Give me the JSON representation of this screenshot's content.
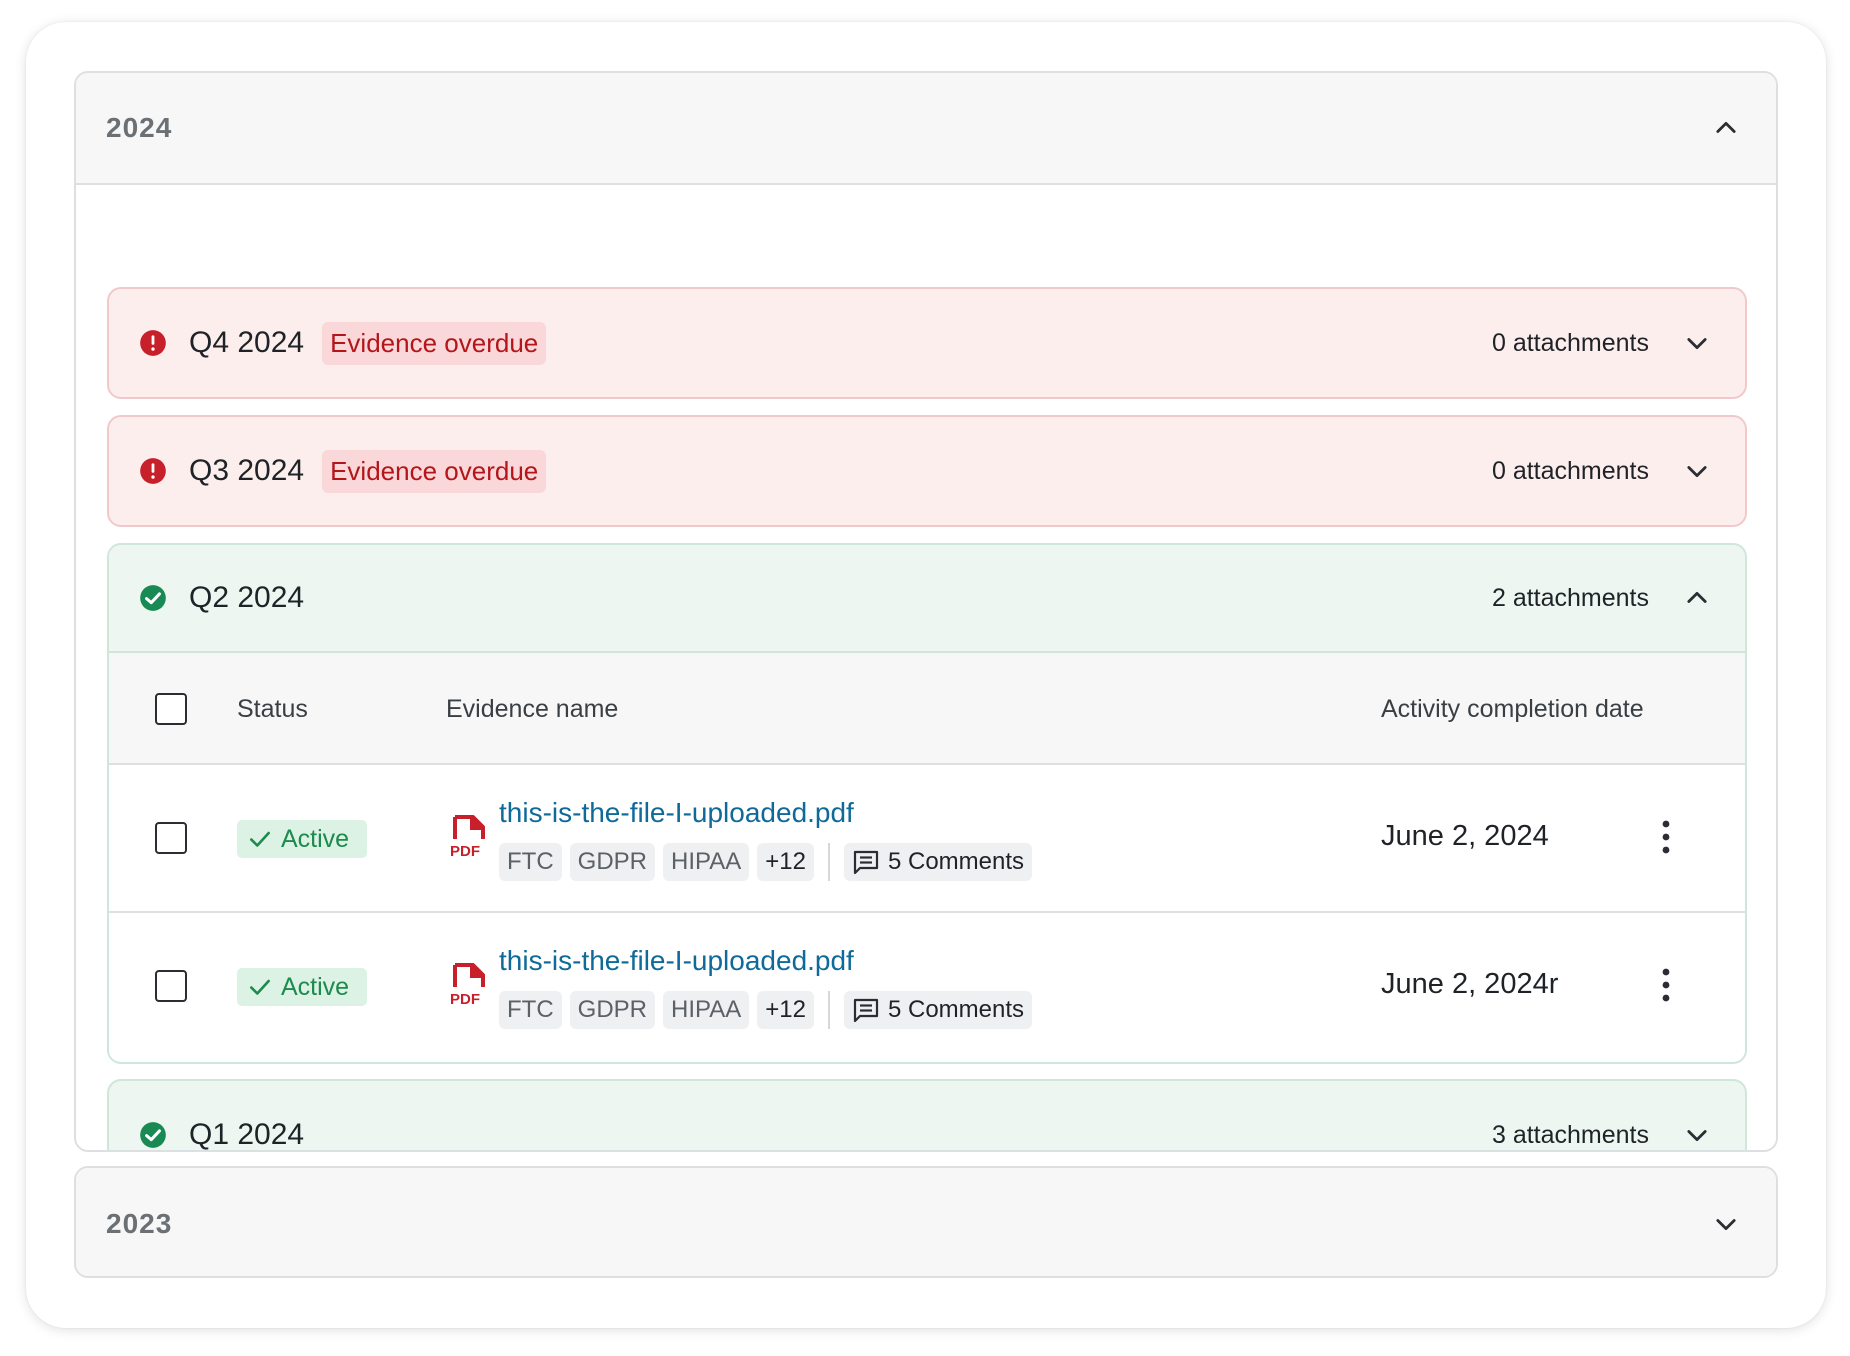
{
  "years": {
    "y2024": {
      "label": "2024",
      "expanded": true
    },
    "y2023": {
      "label": "2023",
      "expanded": false
    }
  },
  "quarters": {
    "q4": {
      "label": "Q4 2024",
      "badge": "Evidence overdue",
      "attachments": "0 attachments",
      "status": "overdue"
    },
    "q3": {
      "label": "Q3 2024",
      "badge": "Evidence overdue",
      "attachments": "0 attachments",
      "status": "overdue"
    },
    "q2": {
      "label": "Q2 2024",
      "attachments": "2 attachments",
      "status": "complete",
      "expanded": true
    },
    "q1": {
      "label": "Q1 2024",
      "attachments": "3 attachments",
      "status": "complete"
    }
  },
  "table": {
    "headers": {
      "status": "Status",
      "name": "Evidence name",
      "date": "Activity completion date"
    },
    "rows": [
      {
        "status": "Active",
        "file": "this-is-the-file-I-uploaded.pdf",
        "file_type": "PDF",
        "tags": [
          "FTC",
          "GDPR",
          "HIPAA",
          "+12"
        ],
        "comments": "5 Comments",
        "date": "June 2, 2024"
      },
      {
        "status": "Active",
        "file": "this-is-the-file-I-uploaded.pdf",
        "file_type": "PDF",
        "tags": [
          "FTC",
          "GDPR",
          "HIPAA",
          "+12"
        ],
        "comments": "5 Comments",
        "date": "June 2, 2024r"
      }
    ]
  },
  "colors": {
    "overdue_bg": "#fdeeee",
    "overdue_text": "#b3151b",
    "complete_bg": "#edf6f1",
    "complete_icon": "#1a8a55",
    "link": "#0f6a9a",
    "pdf": "#c8202a"
  }
}
